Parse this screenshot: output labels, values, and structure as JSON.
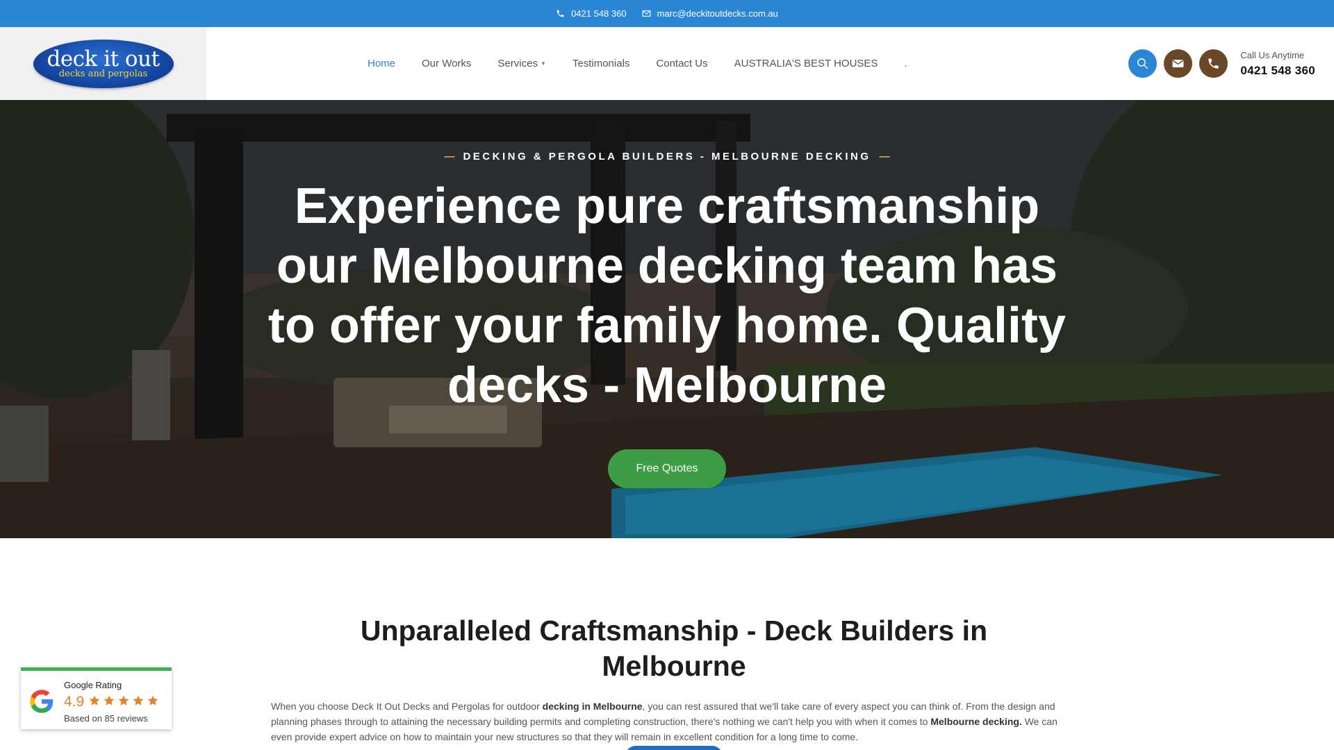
{
  "topbar": {
    "phone": "0421 548 360",
    "email": "marc@deckitoutdecks.com.au",
    "phone_icon": "phone-icon",
    "email_icon": "envelope-icon"
  },
  "header": {
    "logo": {
      "main": "deck it out",
      "sub": "decks and pergolas"
    },
    "nav": [
      {
        "label": "Home",
        "active": true
      },
      {
        "label": "Our Works"
      },
      {
        "label": "Services",
        "dropdown": true
      },
      {
        "label": "Testimonials"
      },
      {
        "label": "Contact Us"
      },
      {
        "label": "AUSTRALIA'S BEST HOUSES"
      },
      {
        "label": "."
      }
    ],
    "call_label": "Call Us Anytime",
    "call_number": "0421 548 360",
    "icons": [
      "search-icon",
      "envelope-icon",
      "phone-icon"
    ]
  },
  "hero": {
    "kicker": "DECKING & PERGOLA BUILDERS - MELBOURNE DECKING",
    "title": "Experience pure craftsmanship our Melbourne decking team has to offer your family home. Quality decks - Melbourne",
    "button": "Free Quotes"
  },
  "section": {
    "title": "Unparalleled Craftsmanship - Deck Builders in Melbourne",
    "p1": "When you choose Deck It Out Decks and Pergolas for outdoor ",
    "b1": "decking in Melbourne",
    "p2": ", you can rest assured that we'll take care of every aspect you can think of. From the design and planning phases through to attaining the necessary building permits and completing construction, there's nothing we can't help you with when it comes to ",
    "b2": "Melbourne decking.",
    "p3": " We can even provide expert advice on how to maintain your new structures so that they will remain in excellent condition for a long time to come."
  },
  "google_widget": {
    "label": "Google Rating",
    "score": "4.9",
    "stars": 5,
    "reviews": "Based on 85 reviews"
  },
  "colors": {
    "topbar": "#2b86d6",
    "accent": "#2b86d6",
    "brown": "#6a4726",
    "button_green": "#3c9d44",
    "star": "#e5812b"
  }
}
